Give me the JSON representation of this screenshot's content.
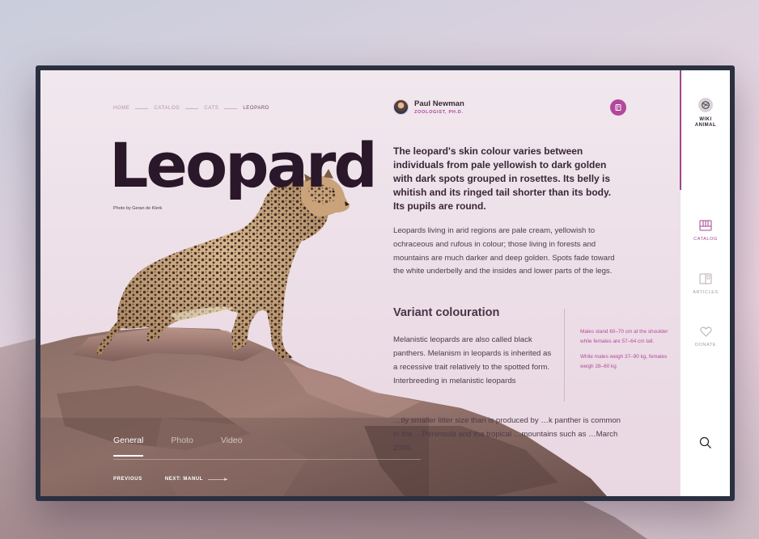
{
  "breadcrumb": [
    "HOME",
    "CATALOG",
    "CATS",
    "LEOPARD"
  ],
  "title": "Leopard",
  "photo_credit": "Photo by Geran de Klerk",
  "author": {
    "name": "Paul Newman",
    "role": "ZOOLOGIST, PH.D."
  },
  "article": {
    "lead": "The leopard's skin colour varies between individuals from pale yellowish to dark golden with dark spots grouped in rosettes. Its belly is whitish and its ringed tail shorter than its body. Its pupils are round.",
    "paragraph1": "Leopards living in arid regions are pale cream, yellowish to ochraceous and rufous in colour; those living in forests and mountains are much darker and deep golden. Spots fade toward the white underbelly and the insides and lower parts of the legs.",
    "section_heading": "Variant colouration",
    "paragraph2": "Melanistic leopards are also called black panthers. Melanism in leopards is inherited as a recessive trait relatively to the spotted form. Interbreeding in melanistic leopards",
    "paragraph3": "…tly smaller litter size than is produced by …k panther is common in the …Peninsula and the tropical …mountains such as …March 2009,",
    "side_notes": [
      "Males stand 60–70 cm at the shoulder while females are 57–64 cm tall.",
      "While males weigh 37–90 kg, females weigh 28–60 kg"
    ]
  },
  "tabs": [
    {
      "label": "General",
      "active": true
    },
    {
      "label": "Photo",
      "active": false
    },
    {
      "label": "Video",
      "active": false
    }
  ],
  "pager": {
    "previous": "PREVIOUS",
    "next": "NEXT: MANUL"
  },
  "sidebar": {
    "brand": "WIKI ANIMAL",
    "items": [
      {
        "label": "CATALOG",
        "icon": "catalog-icon",
        "active": true
      },
      {
        "label": "ARTICLES",
        "icon": "articles-icon",
        "active": false
      },
      {
        "label": "DONATE",
        "icon": "heart-icon",
        "active": false
      }
    ],
    "search_icon": "search-icon"
  },
  "colors": {
    "accent": "#b2489b",
    "title": "#2a1729",
    "frame": "#2b3040",
    "sidebar": "#ffffff"
  }
}
